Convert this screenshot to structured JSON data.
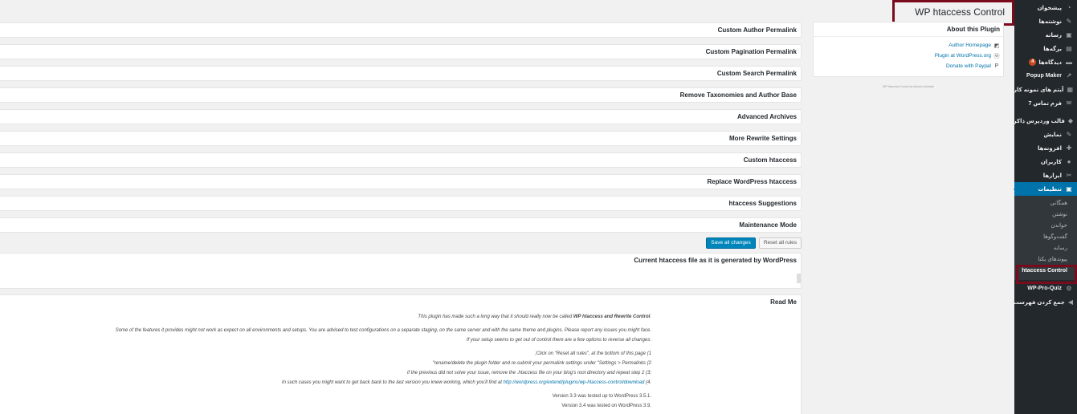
{
  "page": {
    "title": "WP htaccess Control"
  },
  "sidebar": {
    "items": [
      {
        "icon": "dashboard-icon",
        "glyph": "◔",
        "label": "پیشخوان"
      },
      {
        "icon": "pin-icon",
        "glyph": "✎",
        "label": "نوشته‌ها"
      },
      {
        "icon": "media-icon",
        "glyph": "▣",
        "label": "رسانه"
      },
      {
        "icon": "page-icon",
        "glyph": "▤",
        "label": "برگه‌ها"
      },
      {
        "icon": "comment-icon",
        "glyph": "▬",
        "label": "دیدگاه‌ها",
        "badge": "4"
      },
      {
        "icon": "external-link-icon",
        "glyph": "↗",
        "label": "Popup Maker"
      },
      {
        "icon": "portfolio-icon",
        "glyph": "▦",
        "label": "آیتم های نمونه کار"
      },
      {
        "icon": "mail-icon",
        "glyph": "✉",
        "label": "فرم تماس 7"
      },
      {
        "icon": "diamond-icon",
        "glyph": "◆",
        "label": "قالب وردپرس ذاکر",
        "gap": true
      },
      {
        "icon": "brush-icon",
        "glyph": "✎",
        "label": "نمایش"
      },
      {
        "icon": "plugin-icon",
        "glyph": "✚",
        "label": "افزونه‌ها"
      },
      {
        "icon": "user-icon",
        "glyph": "●",
        "label": "کاربران"
      },
      {
        "icon": "wrench-icon",
        "glyph": "✂",
        "label": "ابزارها"
      },
      {
        "icon": "settings-icon",
        "glyph": "▣",
        "label": "تنظیمات",
        "active": true
      }
    ],
    "submenu": [
      {
        "label": "همگانی"
      },
      {
        "label": "نوشتن"
      },
      {
        "label": "خواندن"
      },
      {
        "label": "گفت‌وگوها"
      },
      {
        "label": "رسانه"
      },
      {
        "label": "پیوندهای یکتا"
      },
      {
        "label": "htaccess Control",
        "current": true
      }
    ],
    "after": [
      {
        "icon": "gear-icon",
        "glyph": "⚙",
        "label": "WP-Pro-Quiz"
      },
      {
        "icon": "collapse-icon",
        "glyph": "◀",
        "label": "جمع کردن فهرست"
      }
    ]
  },
  "about": {
    "title": "About this Plugin",
    "links": [
      {
        "icon": "author-icon",
        "glyph": "◩",
        "label": "Author Homepage"
      },
      {
        "icon": "wordpress-icon",
        "glyph": "ⓦ",
        "label": "Plugin at WordPress.org"
      },
      {
        "icon": "paypal-icon",
        "glyph": "P",
        "label": "Donate with Paypal"
      }
    ],
    "credit": "WP htaccess Control by Antonio Andrade"
  },
  "sections": [
    "Custom Author Permalink",
    "Custom Pagination Permalink",
    "Custom Search Permalink",
    "Remove Taxonomies and Author Base",
    "Advanced Archives",
    "More Rewrite Settings",
    "Custom htaccess",
    "Replace WordPress htaccess",
    "htaccess Suggestions",
    "Maintenance Mode"
  ],
  "actions": {
    "reset": "Reset all rules",
    "save": "Save all changes"
  },
  "current": {
    "title": "Current htaccess file as it is generated by WordPress"
  },
  "readme": {
    "title": "Read Me",
    "p1_pre": ".This plugin has made such a long way that it should really now be called ",
    "p1_bold": "WP htaccess and Rewrite Control",
    "p2a": ".Some of the features it provides might not work as expect on all environments and setups. You are advised to test configurations on a separate staging, on the same server and with the same theme and plugins. Please report any issues you might face",
    "p2b": ":If your setup seems to get out of control there are a few options to reverse all changes",
    "s1": "Click on \"Reset all rules\", at the bottom of this page (1;",
    "s2": "rename/delete the plugin folder and re-submit your permalink settings under \"Settings > Permalinks (2\"",
    "s3": ";if the previous did not solve your issue, remove the .htaccess file on your blog's root directory and repeat step 2 (3",
    "s4_pre": ".In such cases you might want to get back back to the last version you knew working, which you'll find at ",
    "s4_link": "http://wordpress.org/extend/plugins/wp-htaccess-control/download",
    "s4_post": " (4",
    "v1": ".Version 3.3 was tested up to WordPress 3.5.1",
    "v2": ".Version 3.4 was tested on WordPress 3.9"
  }
}
